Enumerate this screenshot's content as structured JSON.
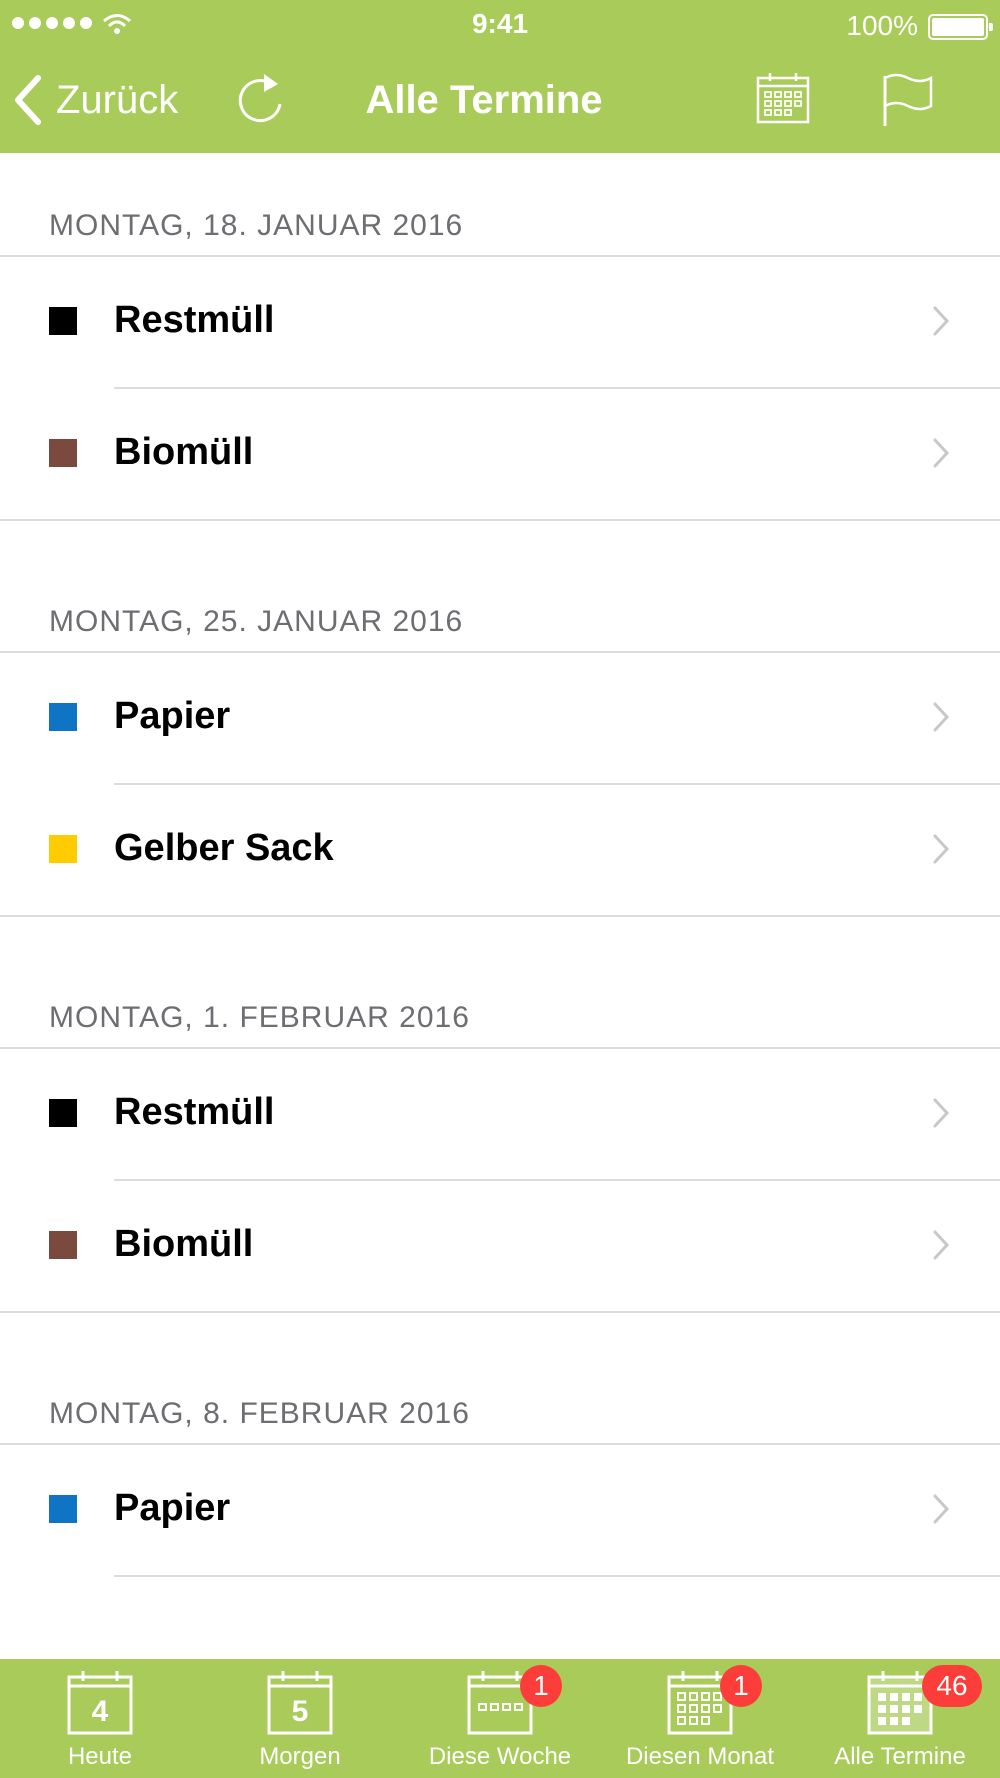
{
  "status_bar": {
    "time": "9:41",
    "battery": "100%"
  },
  "nav": {
    "back_label": "Zurück",
    "title": "Alle Termine"
  },
  "colors": {
    "accent": "#a8cb5a",
    "badge": "#fc3d39"
  },
  "sections": [
    {
      "header": "MONTAG, 18. JANUAR 2016",
      "items": [
        {
          "label": "Restmüll",
          "color": "#000000"
        },
        {
          "label": "Biomüll",
          "color": "#7b4a3e"
        }
      ]
    },
    {
      "header": "MONTAG, 25. JANUAR 2016",
      "items": [
        {
          "label": "Papier",
          "color": "#1074c4"
        },
        {
          "label": "Gelber Sack",
          "color": "#ffcc00"
        }
      ]
    },
    {
      "header": "MONTAG, 1. FEBRUAR 2016",
      "items": [
        {
          "label": "Restmüll",
          "color": "#000000"
        },
        {
          "label": "Biomüll",
          "color": "#7b4a3e"
        }
      ]
    },
    {
      "header": "MONTAG, 8. FEBRUAR 2016",
      "items": [
        {
          "label": "Papier",
          "color": "#1074c4"
        }
      ]
    }
  ],
  "tabs": [
    {
      "label": "Heute",
      "icon": "calendar-day-icon",
      "day": "4"
    },
    {
      "label": "Morgen",
      "icon": "calendar-day-icon",
      "day": "5"
    },
    {
      "label": "Diese Woche",
      "icon": "calendar-week-icon",
      "badge": "1"
    },
    {
      "label": "Diesen Monat",
      "icon": "calendar-month-icon",
      "badge": "1"
    },
    {
      "label": "Alle Termine",
      "icon": "calendar-all-icon",
      "badge": "46"
    }
  ]
}
